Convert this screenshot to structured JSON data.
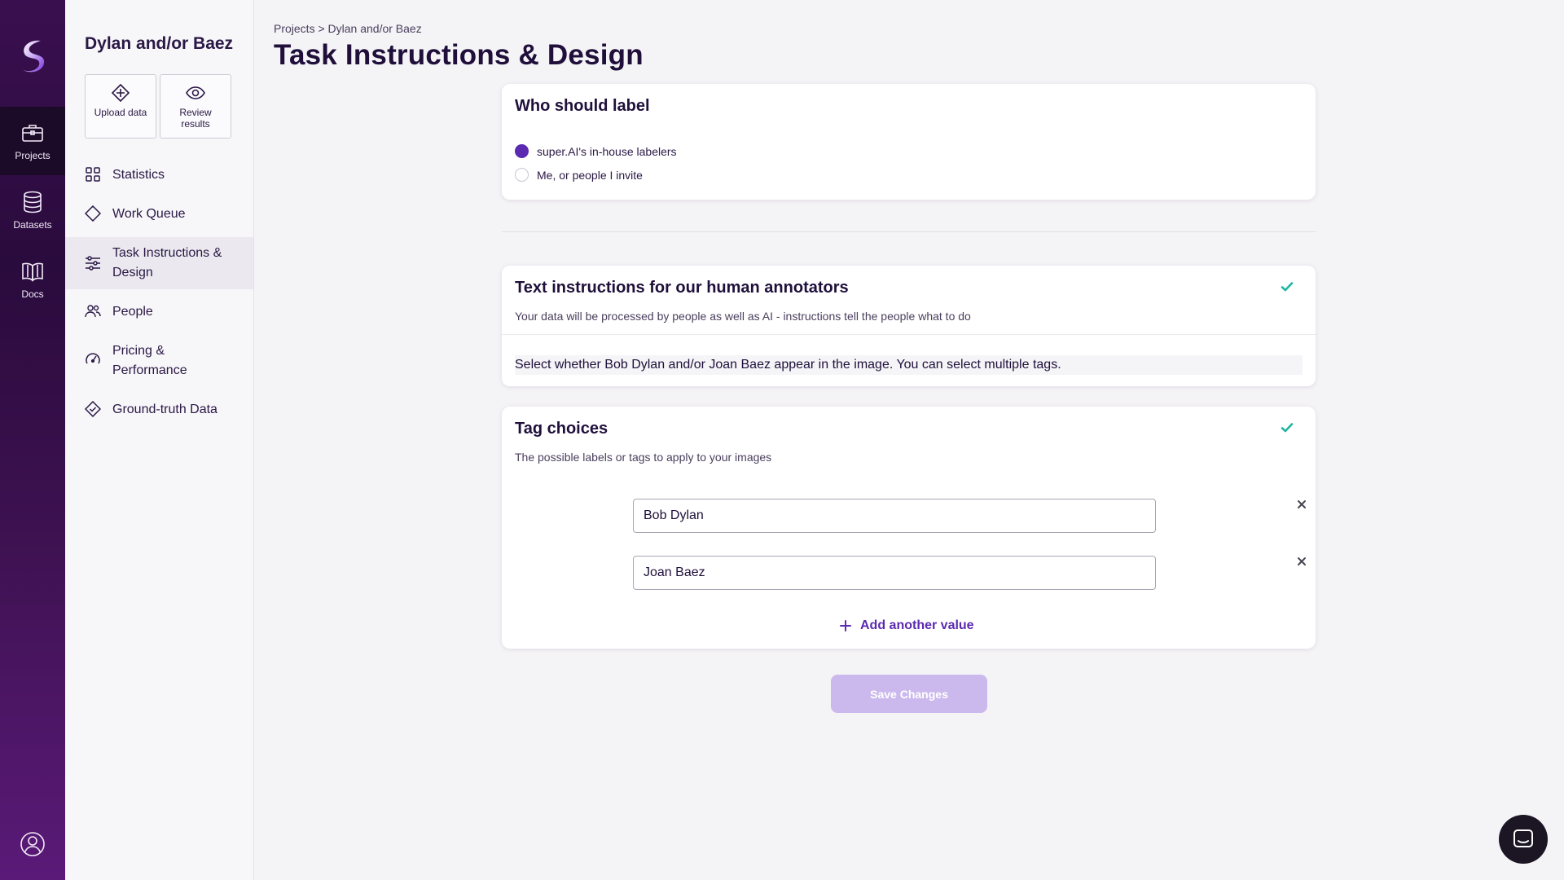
{
  "rail": {
    "items": [
      {
        "label": "Projects",
        "icon": "briefcase-icon",
        "active": true
      },
      {
        "label": "Datasets",
        "icon": "database-icon"
      },
      {
        "label": "Docs",
        "icon": "book-icon"
      }
    ]
  },
  "sidebar": {
    "project_name": "Dylan and/or Baez",
    "quick_actions": [
      {
        "label": "Upload data",
        "icon": "upload-icon"
      },
      {
        "label": "Review results",
        "icon": "eye-icon"
      }
    ],
    "items": [
      {
        "label": "Statistics",
        "icon": "grid-icon"
      },
      {
        "label": "Work Queue",
        "icon": "diamond-icon"
      },
      {
        "label": "Task Instructions & Design",
        "icon": "sliders-icon",
        "active": true
      },
      {
        "label": "People",
        "icon": "people-icon"
      },
      {
        "label": "Pricing & Performance",
        "icon": "gauge-icon"
      },
      {
        "label": "Ground-truth Data",
        "icon": "diamond-check-icon"
      }
    ]
  },
  "header": {
    "breadcrumb": "Projects > Dylan and/or Baez",
    "title": "Task Instructions & Design"
  },
  "who_label": {
    "title": "Who should label",
    "options": [
      {
        "label": "super.AI's in-house labelers",
        "selected": true
      },
      {
        "label": "Me, or people I invite",
        "selected": false
      }
    ]
  },
  "text_instructions": {
    "title": "Text instructions for our human annotators",
    "subtitle": "Your data will be processed by people as well as AI - instructions tell the people what to do",
    "value": "Select whether Bob Dylan and/or Joan Baez appear in the image. You can select multiple tags."
  },
  "tag_choices": {
    "title": "Tag choices",
    "subtitle": "The possible labels or tags to apply to your images",
    "tags": [
      "Bob Dylan",
      "Joan Baez"
    ],
    "add_label": "Add another value"
  },
  "actions": {
    "save_label": "Save Changes"
  },
  "colors": {
    "accent": "#5b2ab0",
    "check": "#1fb5a0",
    "save_disabled": "#cbb9ee"
  }
}
